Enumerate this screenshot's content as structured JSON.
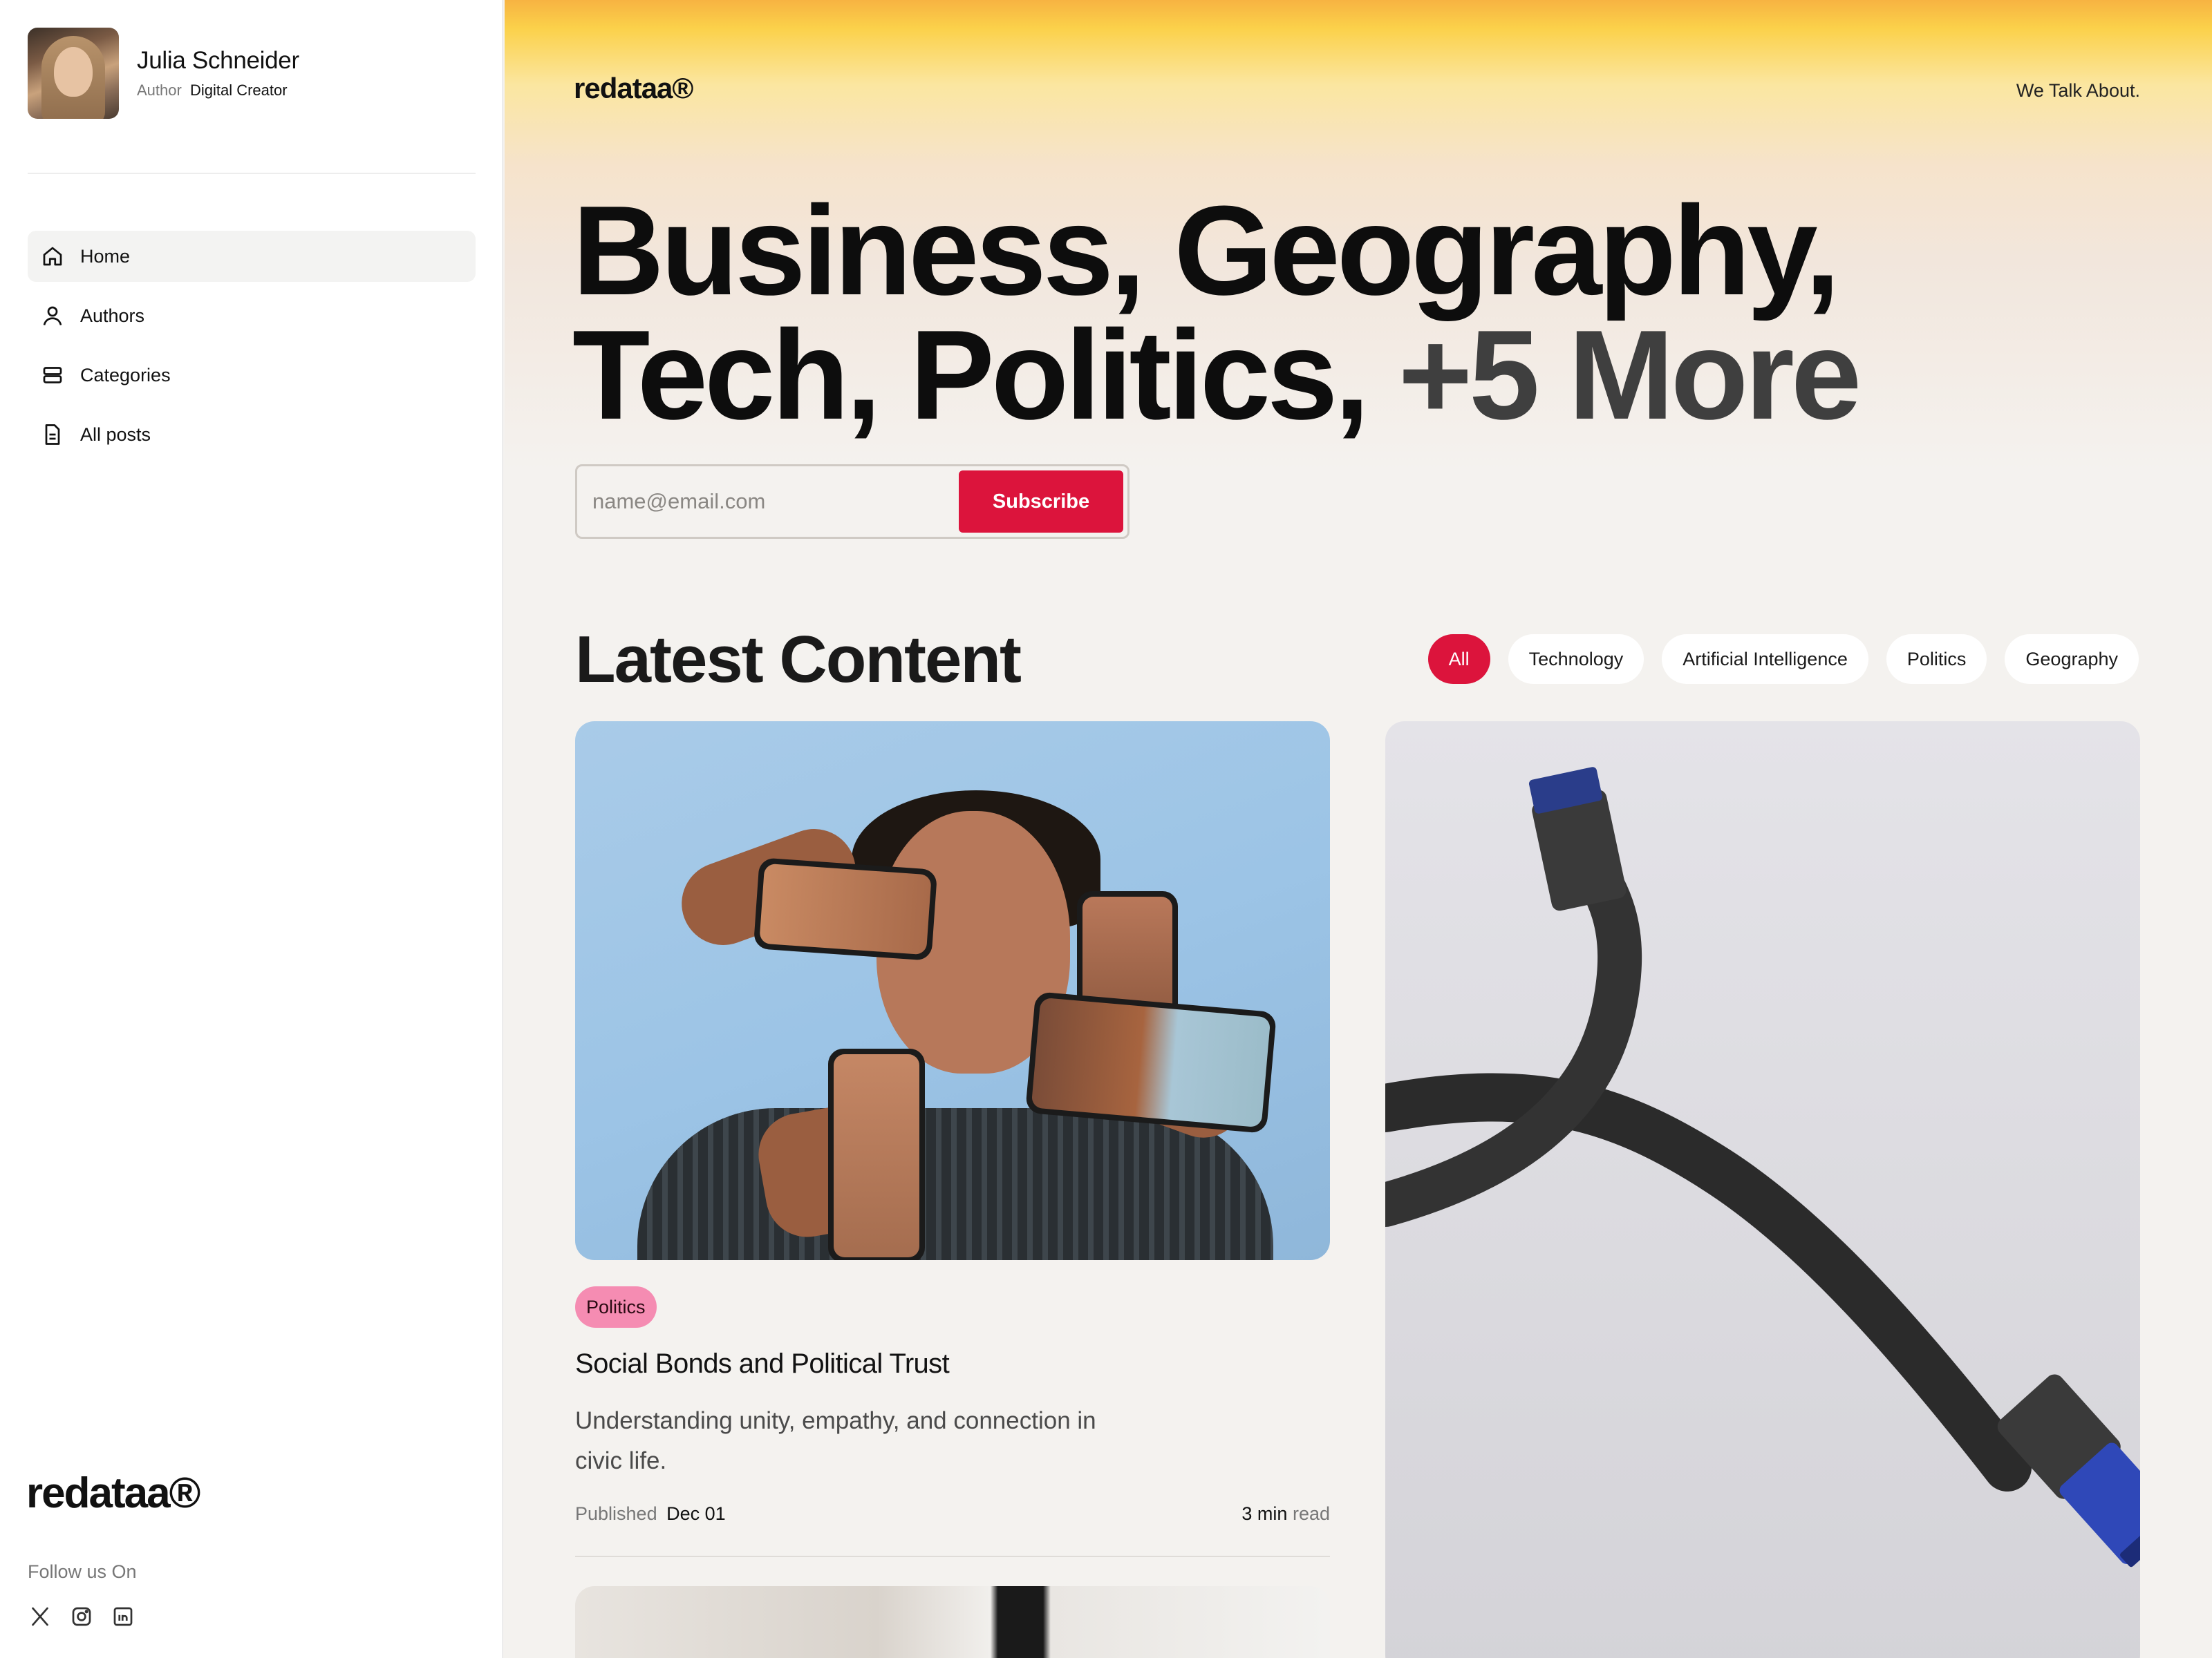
{
  "profile": {
    "name": "Julia Schneider",
    "role_label": "Author",
    "role_value": "Digital Creator"
  },
  "nav": {
    "items": [
      {
        "label": "Home",
        "icon": "home-icon",
        "active": true
      },
      {
        "label": "Authors",
        "icon": "user-icon",
        "active": false
      },
      {
        "label": "Categories",
        "icon": "layers-icon",
        "active": false
      },
      {
        "label": "All posts",
        "icon": "document-icon",
        "active": false
      }
    ]
  },
  "sidebar_footer": {
    "logo": "redataa®",
    "follow_label": "Follow us On",
    "socials": [
      "x-icon",
      "instagram-icon",
      "linkedin-icon"
    ]
  },
  "header": {
    "logo": "redataa®",
    "tagline_link": "We Talk About."
  },
  "hero": {
    "line1": "Business, Geography,",
    "line2_main": "Tech, Politics, ",
    "line2_more": "+5 More"
  },
  "subscribe": {
    "placeholder": "name@email.com",
    "button_label": "Subscribe"
  },
  "latest": {
    "title": "Latest Content",
    "filters": [
      "All",
      "Technology",
      "Artificial Intelligence",
      "Politics",
      "Geography"
    ],
    "active_filter": "All"
  },
  "featured_post": {
    "tag": "Politics",
    "title": "Social Bonds and Political Trust",
    "description": "Understanding unity, empathy, and connection in civic life.",
    "published_label": "Published",
    "published_date": "Dec 01",
    "read_time": "3 min",
    "read_suffix": "read"
  },
  "colors": {
    "accent": "#dc143c",
    "tag_pink": "#f58cb2",
    "hero_gradient_top": "#f7b342",
    "background": "#f4f2ef"
  }
}
